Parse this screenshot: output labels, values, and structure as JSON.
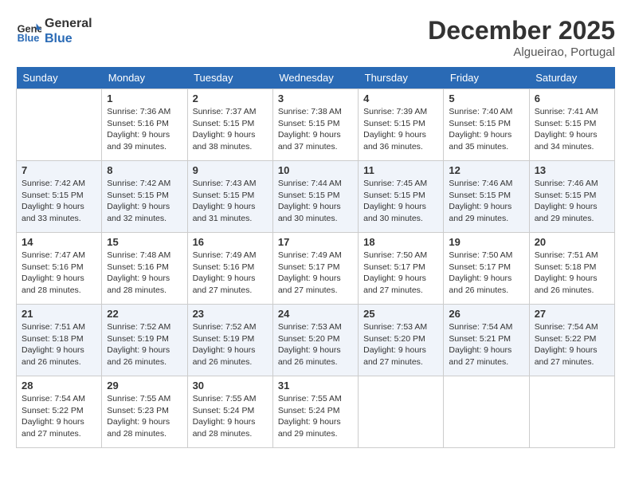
{
  "header": {
    "logo_line1": "General",
    "logo_line2": "Blue",
    "month": "December 2025",
    "location": "Algueirao, Portugal"
  },
  "weekdays": [
    "Sunday",
    "Monday",
    "Tuesday",
    "Wednesday",
    "Thursday",
    "Friday",
    "Saturday"
  ],
  "weeks": [
    [
      {
        "day": "",
        "empty": true
      },
      {
        "day": "1",
        "sunrise": "7:36 AM",
        "sunset": "5:16 PM",
        "daylight": "9 hours and 39 minutes."
      },
      {
        "day": "2",
        "sunrise": "7:37 AM",
        "sunset": "5:15 PM",
        "daylight": "9 hours and 38 minutes."
      },
      {
        "day": "3",
        "sunrise": "7:38 AM",
        "sunset": "5:15 PM",
        "daylight": "9 hours and 37 minutes."
      },
      {
        "day": "4",
        "sunrise": "7:39 AM",
        "sunset": "5:15 PM",
        "daylight": "9 hours and 36 minutes."
      },
      {
        "day": "5",
        "sunrise": "7:40 AM",
        "sunset": "5:15 PM",
        "daylight": "9 hours and 35 minutes."
      },
      {
        "day": "6",
        "sunrise": "7:41 AM",
        "sunset": "5:15 PM",
        "daylight": "9 hours and 34 minutes."
      }
    ],
    [
      {
        "day": "7",
        "sunrise": "7:42 AM",
        "sunset": "5:15 PM",
        "daylight": "9 hours and 33 minutes."
      },
      {
        "day": "8",
        "sunrise": "7:42 AM",
        "sunset": "5:15 PM",
        "daylight": "9 hours and 32 minutes."
      },
      {
        "day": "9",
        "sunrise": "7:43 AM",
        "sunset": "5:15 PM",
        "daylight": "9 hours and 31 minutes."
      },
      {
        "day": "10",
        "sunrise": "7:44 AM",
        "sunset": "5:15 PM",
        "daylight": "9 hours and 30 minutes."
      },
      {
        "day": "11",
        "sunrise": "7:45 AM",
        "sunset": "5:15 PM",
        "daylight": "9 hours and 30 minutes."
      },
      {
        "day": "12",
        "sunrise": "7:46 AM",
        "sunset": "5:15 PM",
        "daylight": "9 hours and 29 minutes."
      },
      {
        "day": "13",
        "sunrise": "7:46 AM",
        "sunset": "5:15 PM",
        "daylight": "9 hours and 29 minutes."
      }
    ],
    [
      {
        "day": "14",
        "sunrise": "7:47 AM",
        "sunset": "5:16 PM",
        "daylight": "9 hours and 28 minutes."
      },
      {
        "day": "15",
        "sunrise": "7:48 AM",
        "sunset": "5:16 PM",
        "daylight": "9 hours and 28 minutes."
      },
      {
        "day": "16",
        "sunrise": "7:49 AM",
        "sunset": "5:16 PM",
        "daylight": "9 hours and 27 minutes."
      },
      {
        "day": "17",
        "sunrise": "7:49 AM",
        "sunset": "5:17 PM",
        "daylight": "9 hours and 27 minutes."
      },
      {
        "day": "18",
        "sunrise": "7:50 AM",
        "sunset": "5:17 PM",
        "daylight": "9 hours and 27 minutes."
      },
      {
        "day": "19",
        "sunrise": "7:50 AM",
        "sunset": "5:17 PM",
        "daylight": "9 hours and 26 minutes."
      },
      {
        "day": "20",
        "sunrise": "7:51 AM",
        "sunset": "5:18 PM",
        "daylight": "9 hours and 26 minutes."
      }
    ],
    [
      {
        "day": "21",
        "sunrise": "7:51 AM",
        "sunset": "5:18 PM",
        "daylight": "9 hours and 26 minutes."
      },
      {
        "day": "22",
        "sunrise": "7:52 AM",
        "sunset": "5:19 PM",
        "daylight": "9 hours and 26 minutes."
      },
      {
        "day": "23",
        "sunrise": "7:52 AM",
        "sunset": "5:19 PM",
        "daylight": "9 hours and 26 minutes."
      },
      {
        "day": "24",
        "sunrise": "7:53 AM",
        "sunset": "5:20 PM",
        "daylight": "9 hours and 26 minutes."
      },
      {
        "day": "25",
        "sunrise": "7:53 AM",
        "sunset": "5:20 PM",
        "daylight": "9 hours and 27 minutes."
      },
      {
        "day": "26",
        "sunrise": "7:54 AM",
        "sunset": "5:21 PM",
        "daylight": "9 hours and 27 minutes."
      },
      {
        "day": "27",
        "sunrise": "7:54 AM",
        "sunset": "5:22 PM",
        "daylight": "9 hours and 27 minutes."
      }
    ],
    [
      {
        "day": "28",
        "sunrise": "7:54 AM",
        "sunset": "5:22 PM",
        "daylight": "9 hours and 27 minutes."
      },
      {
        "day": "29",
        "sunrise": "7:55 AM",
        "sunset": "5:23 PM",
        "daylight": "9 hours and 28 minutes."
      },
      {
        "day": "30",
        "sunrise": "7:55 AM",
        "sunset": "5:24 PM",
        "daylight": "9 hours and 28 minutes."
      },
      {
        "day": "31",
        "sunrise": "7:55 AM",
        "sunset": "5:24 PM",
        "daylight": "9 hours and 29 minutes."
      },
      {
        "day": "",
        "empty": true
      },
      {
        "day": "",
        "empty": true
      },
      {
        "day": "",
        "empty": true
      }
    ]
  ],
  "labels": {
    "sunrise": "Sunrise:",
    "sunset": "Sunset:",
    "daylight": "Daylight:"
  }
}
